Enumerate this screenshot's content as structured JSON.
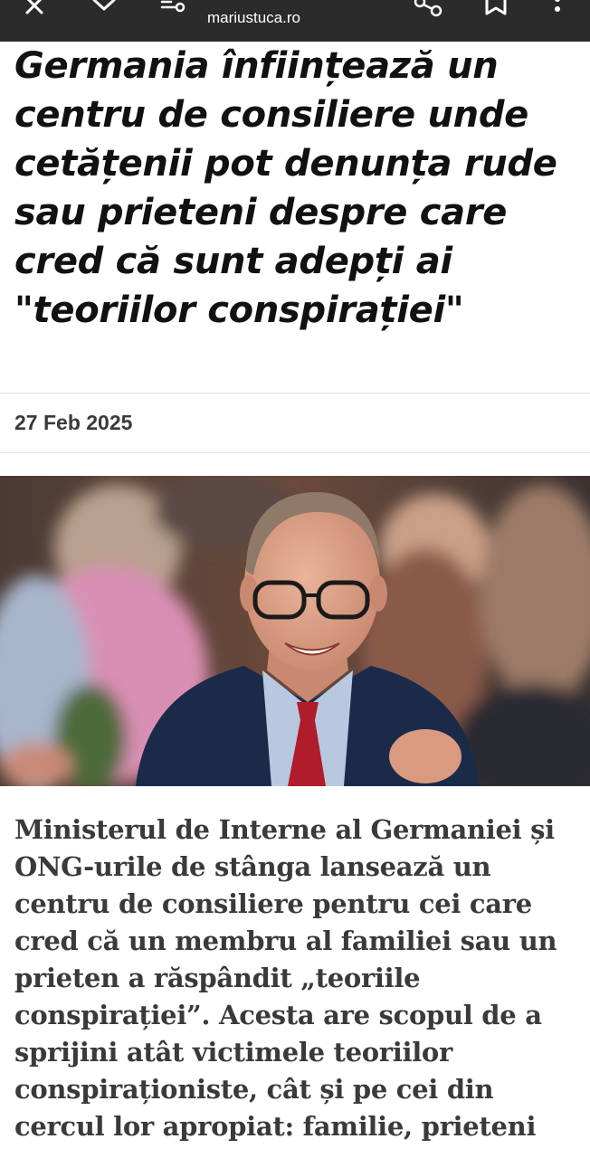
{
  "browser": {
    "url": "mariustuca.ro",
    "icons": [
      "close-icon",
      "chevron-down-icon",
      "page-settings-icon",
      "share-icon",
      "bookmark-icon",
      "more-vertical-icon"
    ]
  },
  "article": {
    "title": "Germania înființează un centru de consiliere unde cetățenii pot denunța rude sau prieteni despre care cred că sunt adepți ai \"teoriilor conspirației\"",
    "date": "27 Feb 2025",
    "body": "Ministerul de Interne al Germaniei și ONG-urile de stânga lansează un centru de consiliere pentru cei care cred că un membru al familiei sau un prieten a răspândit „teoriile conspirației”. Acesta are scopul de a sprijini atât victimele teoriilor conspiraționiste, cât și pe cei din cercul lor apropiat: familie, prieteni"
  },
  "colors": {
    "topbar": "#2b2b2b",
    "headline": "#111111",
    "body_text": "#3a3a3a",
    "tie": "#b01c2a",
    "suit": "#1c2a4a"
  }
}
